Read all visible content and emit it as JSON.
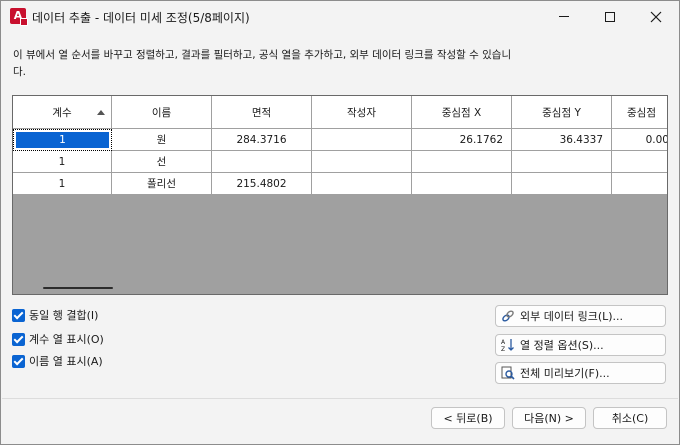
{
  "window": {
    "title": "데이터 추출 - 데이터 미세 조정(5/8페이지)",
    "app_icon_letter": "A"
  },
  "description": "이 뷰에서 열 순서를 바꾸고 정렬하고, 결과를 필터하고, 공식 열을 추가하고, 외부 데이터 링크를 작성할 수 있습니다.",
  "table": {
    "columns": [
      "계수",
      "이름",
      "면적",
      "작성자",
      "중심점 X",
      "중심점 Y",
      "중심점"
    ],
    "rows": [
      [
        "1",
        "원",
        "284.3716",
        "",
        "26.1762",
        "36.4337",
        "0.00"
      ],
      [
        "1",
        "선",
        "",
        "",
        "",
        "",
        ""
      ],
      [
        "1",
        "폴리선",
        "215.4802",
        "",
        "",
        "",
        ""
      ]
    ]
  },
  "options": [
    {
      "label": "동일 행 결합(I)",
      "checked": true
    },
    {
      "label": "계수 열 표시(O)",
      "checked": true
    },
    {
      "label": "이름 열 표시(A)",
      "checked": true
    }
  ],
  "side_buttons": [
    {
      "label": "외부 데이터 링크(L)...",
      "icon": "link-icon"
    },
    {
      "label": "열 정렬 옵션(S)...",
      "icon": "sort-icon"
    },
    {
      "label": "전체 미리보기(F)...",
      "icon": "preview-icon"
    }
  ],
  "footer": {
    "back": "< 뒤로(B)",
    "next": "다음(N) >",
    "cancel": "취소(C)"
  },
  "colors": {
    "accent": "#0a64d2",
    "app_icon": "#c8102e",
    "grid_empty": "#a0a0a0"
  }
}
